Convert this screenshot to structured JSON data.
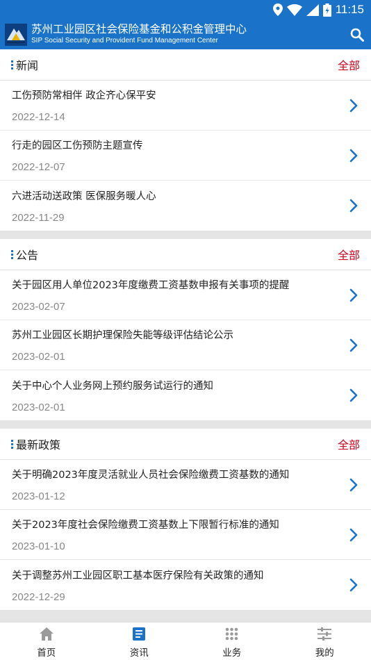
{
  "status": {
    "time": "11:15"
  },
  "header": {
    "title": "苏州工业园区社会保险基金和公积金管理中心",
    "subtitle": "SIP Social Security and Provident Fund Management Center"
  },
  "sections": [
    {
      "title": "新闻",
      "more": "全部",
      "items": [
        {
          "title": "工伤预防常相伴  政企齐心保平安",
          "date": "2022-12-14"
        },
        {
          "title": "行走的园区工伤预防主题宣传",
          "date": "2022-12-07"
        },
        {
          "title": "六进活动送政策 医保服务暖人心",
          "date": "2022-11-29"
        }
      ]
    },
    {
      "title": "公告",
      "more": "全部",
      "items": [
        {
          "title": "关于园区用人单位2023年度缴费工资基数申报有关事项的提醒",
          "date": "2023-02-07"
        },
        {
          "title": "苏州工业园区长期护理保险失能等级评估结论公示",
          "date": "2023-02-01"
        },
        {
          "title": "关于中心个人业务网上预约服务试运行的通知",
          "date": "2023-02-01"
        }
      ]
    },
    {
      "title": "最新政策",
      "more": "全部",
      "items": [
        {
          "title": "关于明确2023年度灵活就业人员社会保险缴费工资基数的通知",
          "date": "2023-01-12"
        },
        {
          "title": "关于2023年度社会保险缴费工资基数上下限暂行标准的通知",
          "date": "2023-01-10"
        },
        {
          "title": "关于调整苏州工业园区职工基本医疗保险有关政策的通知",
          "date": "2022-12-29"
        }
      ]
    }
  ],
  "tabs": [
    {
      "label": "首页",
      "icon": "home-icon"
    },
    {
      "label": "资讯",
      "icon": "news-icon"
    },
    {
      "label": "业务",
      "icon": "grid-icon"
    },
    {
      "label": "我的",
      "icon": "sliders-icon"
    }
  ],
  "colors": {
    "primary": "#1a73c8",
    "accent": "#d0021b",
    "icon_gray": "#9a9a9a"
  }
}
